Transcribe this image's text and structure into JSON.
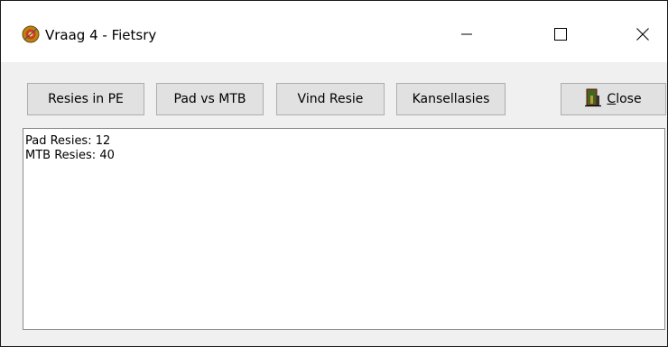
{
  "window": {
    "title": "Vraag 4 - Fietsry",
    "app_icon": "delphi-app-icon",
    "controls": {
      "minimize_icon": "minimize-icon",
      "maximize_icon": "maximize-icon",
      "close_icon": "close-icon"
    }
  },
  "toolbar": {
    "buttons": [
      {
        "label": "Resies in PE"
      },
      {
        "label": "Pad vs MTB"
      },
      {
        "label": "Vind Resie"
      },
      {
        "label": "Kansellasies"
      }
    ],
    "close_button": {
      "label_prefix": "",
      "label_underlined": "C",
      "label_rest": "lose",
      "icon": "door-exit-icon"
    }
  },
  "output": {
    "lines": [
      "Pad Resies: 12",
      "MTB Resies: 40"
    ]
  },
  "colors": {
    "window_bg": "#f0f0f0",
    "titlebar_bg": "#ffffff",
    "button_bg": "#e1e1e1",
    "button_border": "#adadad",
    "memo_bg": "#ffffff"
  }
}
